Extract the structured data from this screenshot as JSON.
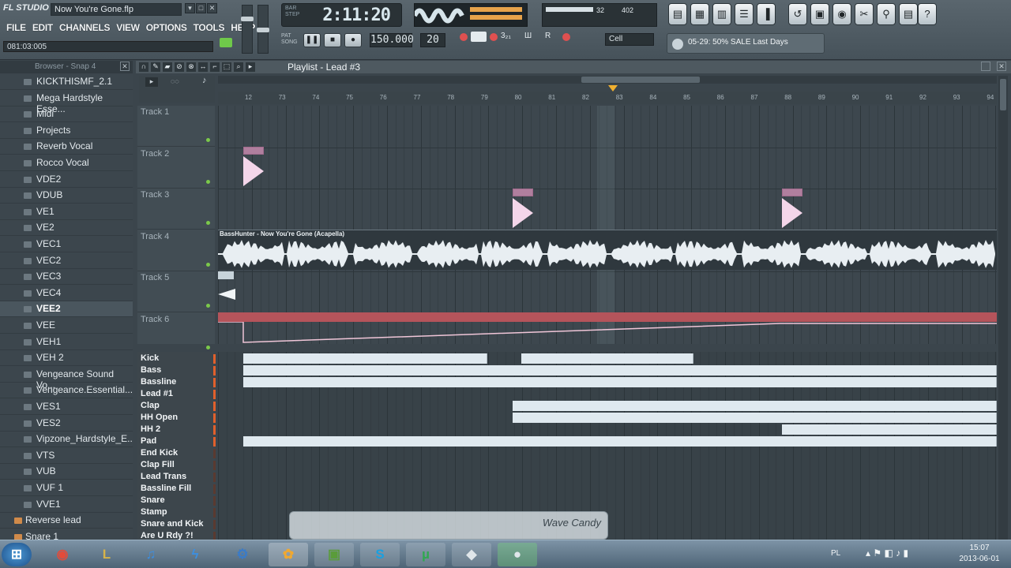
{
  "app": {
    "logo": "FL STUDIO",
    "song_title": "Now You're Gone.flp",
    "hint": "081:03:005",
    "menu": [
      "FILE",
      "EDIT",
      "CHANNELS",
      "VIEW",
      "OPTIONS",
      "TOOLS",
      "HELP"
    ]
  },
  "transport": {
    "time": "2:11:20",
    "time_label": "BAR\nSTEP",
    "tempo": "150.000",
    "pattern": "20",
    "snap_value": "Cell",
    "cpu": "32",
    "poly": "402",
    "news": "05-29: 50% SALE Last Days"
  },
  "browser": {
    "header": "Browser - Snap 4",
    "items": [
      {
        "label": "KICKTHISMF_2.1",
        "selected": false,
        "type": "folder"
      },
      {
        "label": "Mega Hardstyle Esse...",
        "selected": false,
        "type": "folder"
      },
      {
        "label": "Midi",
        "selected": false,
        "type": "folder"
      },
      {
        "label": "Projects",
        "selected": false,
        "type": "folder"
      },
      {
        "label": "Reverb Vocal",
        "selected": false,
        "type": "folder"
      },
      {
        "label": "Rocco Vocal",
        "selected": false,
        "type": "folder"
      },
      {
        "label": "VDE2",
        "selected": false,
        "type": "folder"
      },
      {
        "label": "VDUB",
        "selected": false,
        "type": "folder"
      },
      {
        "label": "VE1",
        "selected": false,
        "type": "folder"
      },
      {
        "label": "VE2",
        "selected": false,
        "type": "folder"
      },
      {
        "label": "VEC1",
        "selected": false,
        "type": "folder"
      },
      {
        "label": "VEC2",
        "selected": false,
        "type": "folder"
      },
      {
        "label": "VEC3",
        "selected": false,
        "type": "folder"
      },
      {
        "label": "VEC4",
        "selected": false,
        "type": "folder"
      },
      {
        "label": "VEE2",
        "selected": true,
        "type": "folder"
      },
      {
        "label": "VEE",
        "selected": false,
        "type": "folder"
      },
      {
        "label": "VEH1",
        "selected": false,
        "type": "folder"
      },
      {
        "label": "VEH 2",
        "selected": false,
        "type": "folder"
      },
      {
        "label": "Vengeance Sound Vo...",
        "selected": false,
        "type": "folder"
      },
      {
        "label": "Vengeance.Essential...",
        "selected": false,
        "type": "folder"
      },
      {
        "label": "VES1",
        "selected": false,
        "type": "folder"
      },
      {
        "label": "VES2",
        "selected": false,
        "type": "folder"
      },
      {
        "label": "Vipzone_Hardstyle_E...",
        "selected": false,
        "type": "folder"
      },
      {
        "label": "VTS",
        "selected": false,
        "type": "folder"
      },
      {
        "label": "VUB",
        "selected": false,
        "type": "folder"
      },
      {
        "label": "VUF 1",
        "selected": false,
        "type": "folder"
      },
      {
        "label": "VVE1",
        "selected": false,
        "type": "folder"
      },
      {
        "label": "Reverse lead",
        "selected": false,
        "type": "file"
      },
      {
        "label": "Snare 1",
        "selected": false,
        "type": "file"
      }
    ]
  },
  "playlist": {
    "title": "Playlist - Lead #3",
    "ruler_ticks": [
      "12",
      "73",
      "74",
      "75",
      "76",
      "77",
      "78",
      "79",
      "80",
      "81",
      "82",
      "83",
      "84",
      "85",
      "86",
      "87",
      "88",
      "89",
      "90",
      "91",
      "92",
      "93",
      "94"
    ],
    "tracks": [
      "Track 1",
      "Track 2",
      "Track 3",
      "Track 4",
      "Track 5",
      "Track 6"
    ],
    "audio_clip_label": "BassHunter - Now You're Gone (Acapella)"
  },
  "sequencer": {
    "channels": [
      "Kick",
      "Bass",
      "Bassline",
      "Lead #1",
      "Clap",
      "HH Open",
      "HH 2",
      "Pad",
      "End Kick",
      "Clap Fill",
      "Lead Trans",
      "Bassline Fill",
      "Snare",
      "Stamp",
      "Snare and Kick",
      "Are U Rdy ?!"
    ]
  },
  "wave_candy": {
    "label": "Wave Candy"
  },
  "taskbar": {
    "language": "PL",
    "time": "15:07",
    "date": "2013-06-01",
    "apps": [
      "start",
      "chrome",
      "league",
      "itunes",
      "thunder",
      "settings",
      "fl-studio",
      "minecraft",
      "skype",
      "utorrent",
      "app1",
      "app2"
    ]
  },
  "colors": {
    "accent_green": "#7bc94a",
    "clip_pink": "#c995b8",
    "selected_bar": "#dfe9ef"
  }
}
